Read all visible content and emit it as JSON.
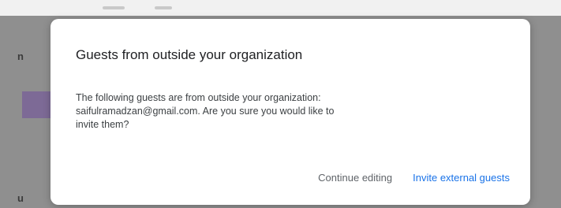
{
  "dialog": {
    "title": "Guests from outside your organization",
    "message_line1": "The following guests are from outside your organization:",
    "message_line2": "saifulramadzan@gmail.com. Are you sure you would like to",
    "message_line3": "invite them?",
    "continue_editing_label": "Continue editing",
    "invite_label": "Invite external guests"
  },
  "background": {
    "fragment_top": "n",
    "fragment_bottom": "u"
  },
  "colors": {
    "primary_action": "#1a73e8",
    "secondary_action": "#5f6368",
    "scrim": "#8f8f8f"
  }
}
